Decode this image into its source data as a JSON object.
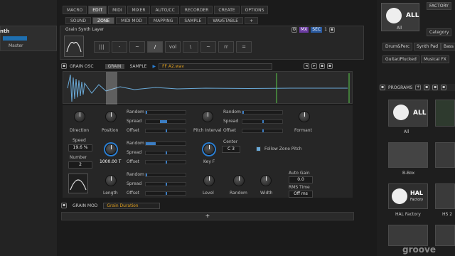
{
  "left": {
    "slot_title": "nth",
    "slot_label": "Master"
  },
  "topbar": {
    "tabs": [
      "MACRO",
      "EDIT",
      "MIDI",
      "MIXER",
      "AUTO/CC",
      "RECORDER",
      "CREATE",
      "OPTIONS"
    ]
  },
  "subbar": {
    "tabs": [
      "SOUND",
      "ZONE",
      "MIDI MOD",
      "MAPPING",
      "SAMPLE",
      "WAVETABLE"
    ],
    "add": "+"
  },
  "layer": {
    "title": "Grain Synth Layer",
    "badge1": "MX",
    "badge2": "SEC",
    "number": "1"
  },
  "filters": [
    "|||",
    "-",
    "~",
    "/",
    "vol",
    "\\",
    "~",
    "rr",
    "="
  ],
  "grain_osc": {
    "label": "GRAIN OSC",
    "mode1": "GRAIN",
    "mode2": "SAMPLE",
    "sample": "FF A2.wav"
  },
  "controls": {
    "direction": "Direction",
    "position": "Position",
    "speed": "Speed",
    "speed_val": "19.6 %",
    "number": "Number",
    "number_val": "2",
    "duration_val": "1000.00 T",
    "length": "Length",
    "random": "Random",
    "spread": "Spread",
    "offset": "Offset",
    "pitch_interval": "Pitch Interval",
    "formant": "Formant",
    "center": "Center",
    "center_val": "C 3",
    "follow_zone_pitch": "Follow Zone Pitch",
    "key_f": "Key F",
    "level": "Level",
    "width": "Width",
    "auto_gain": "Auto Gain",
    "auto_gain_val": "0.0",
    "rms_time": "RMS Time",
    "rms_time_val": "Off ms"
  },
  "grain_mod": {
    "label": "GRAIN MOD",
    "select": "Grain Duration",
    "add": "+"
  },
  "right": {
    "factory": "FACTORY",
    "all": "ALL",
    "all_label": "All",
    "category": "Category",
    "tags": [
      "Drum&Perc",
      "Synth Pad",
      "Bass",
      "Guitar/Plucked",
      "Musical FX"
    ],
    "programs": "PROGRAMS",
    "tiles": [
      "All",
      "B-Box",
      "HAL Factory",
      "HS 2"
    ],
    "hal": "HAL",
    "factory_small": "Factory"
  },
  "watermark": "groove",
  "colors": {
    "accent": "#2a7fd4",
    "sample": "#e0a020",
    "wave": "#6aaad8",
    "marker": "#5ccf4a"
  }
}
